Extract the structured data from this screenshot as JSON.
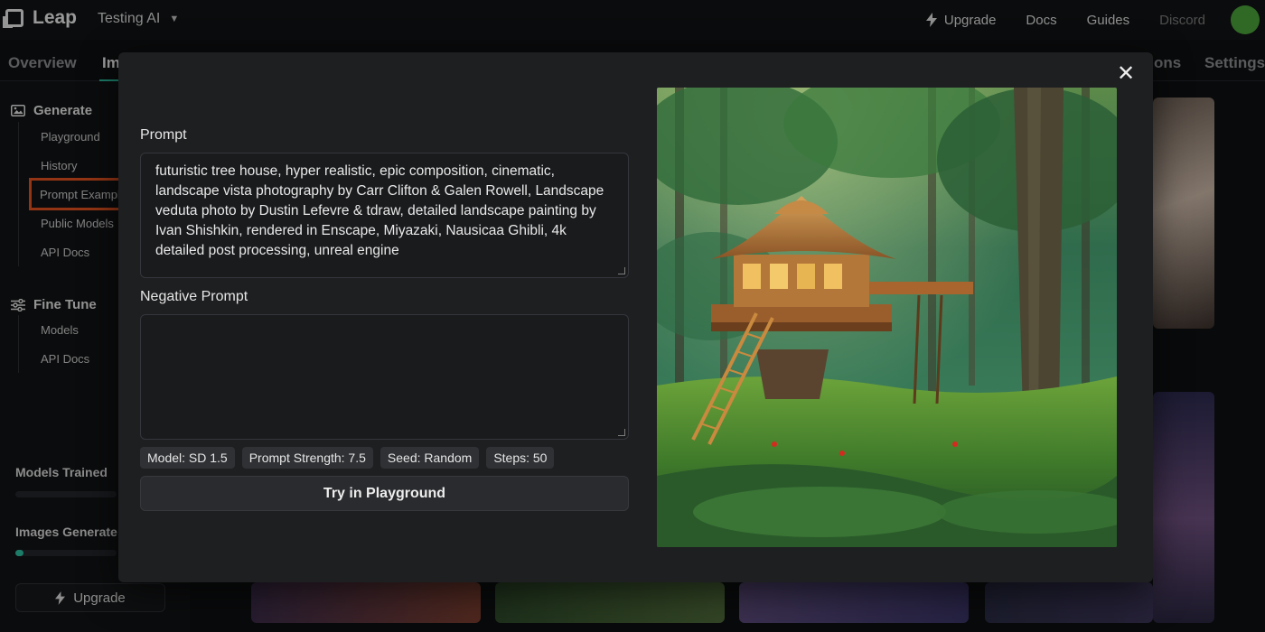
{
  "app": {
    "logo_text": "Leap",
    "project_name": "Testing AI",
    "project_icon": "chevron-down-icon"
  },
  "topnav": {
    "upgrade": "Upgrade",
    "upgrade_icon": "bolt-icon",
    "docs": "Docs",
    "guides": "Guides",
    "discord": "Discord",
    "avatar_color": "#4aa23a"
  },
  "subnav": {
    "tabs": [
      {
        "label": "Overview"
      },
      {
        "label": "Im"
      },
      {
        "label": "ons"
      },
      {
        "label": "Settings"
      }
    ]
  },
  "sidebar": {
    "generate_label": "Generate",
    "generate_items": [
      "Playground",
      "History",
      "Prompt Exampl",
      "Public Models",
      "API Docs"
    ],
    "finetune_label": "Fine Tune",
    "finetune_items": [
      "Models",
      "API Docs"
    ],
    "models_trained_label": "Models Trained",
    "models_trained_fraction": 0.0,
    "images_generated_label": "Images Generate",
    "images_generated_fraction": 0.08,
    "upgrade_label": "Upgrade"
  },
  "modal": {
    "prompt_label": "Prompt",
    "prompt_value": "futuristic tree house, hyper realistic, epic composition, cinematic, landscape vista photography by Carr Clifton & Galen Rowell, Landscape veduta photo by Dustin Lefevre & tdraw, detailed landscape painting by Ivan Shishkin, rendered in Enscape, Miyazaki, Nausicaa Ghibli, 4k detailed post processing, unreal engine",
    "negative_label": "Negative Prompt",
    "negative_value": "",
    "chips": {
      "model": "Model: SD 1.5",
      "strength": "Prompt Strength: 7.5",
      "seed": "Seed: Random",
      "steps": "Steps: 50"
    },
    "try_button": "Try in Playground",
    "close_icon": "close-icon",
    "accent_color": "#2bbfa0",
    "highlight_color": "#e2521f"
  }
}
